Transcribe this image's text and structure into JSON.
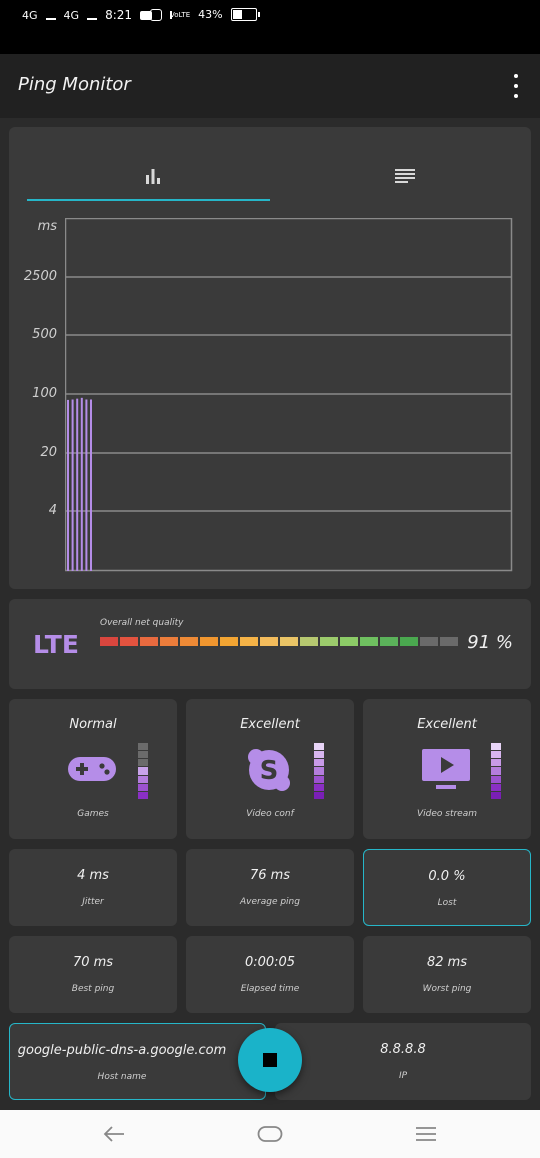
{
  "status_bar": {
    "net1": "4G",
    "net2": "4G",
    "time": "8:21",
    "volte": "VoLTE",
    "battery": "43%",
    "battery_level": 0.43
  },
  "app": {
    "title": "Ping Monitor"
  },
  "tabs": {
    "chart_icon": "bar-chart-icon",
    "list_icon": "list-icon"
  },
  "chart_data": {
    "type": "bar",
    "ylabel": "ms",
    "y_ticks": [
      "2500",
      "500",
      "100",
      "20",
      "4"
    ],
    "y_scale": "log",
    "series": [
      {
        "values": [
          85,
          86,
          88,
          90,
          86,
          86
        ]
      }
    ],
    "bar_color": "#b58de8"
  },
  "quality": {
    "network": "LTE",
    "label": "Overall net quality",
    "percent": "91 %",
    "segments": [
      "#d9463e",
      "#e3533f",
      "#e86a3f",
      "#ec7d3b",
      "#ee8a36",
      "#f0962f",
      "#f2a533",
      "#f5b347",
      "#f3bc5c",
      "#e9c466",
      "#b6c870",
      "#9ccb6c",
      "#8ccb67",
      "#6fc060",
      "#5bb25a",
      "#4aa84f",
      "#6a6a6a",
      "#6a6a6a"
    ]
  },
  "tiles": [
    {
      "title": "Normal",
      "sub": "Games",
      "icon": "gamepad-icon",
      "levels": [
        "#6b6b6b",
        "#6b6b6b",
        "#6b6b6b",
        "#c9a3ea",
        "#b47ddd",
        "#9c52cf",
        "#8a2fc4"
      ]
    },
    {
      "title": "Excellent",
      "sub": "Video conf",
      "icon": "skype-icon",
      "levels": [
        "#e8d4f7",
        "#d8b6f0",
        "#c89ae8",
        "#b47ddd",
        "#9c52cf",
        "#8a2fc4",
        "#7a1fb6"
      ]
    },
    {
      "title": "Excellent",
      "sub": "Video stream",
      "icon": "tv-play-icon",
      "levels": [
        "#e8d4f7",
        "#d8b6f0",
        "#c89ae8",
        "#b47ddd",
        "#9c52cf",
        "#8a2fc4",
        "#7a1fb6"
      ]
    }
  ],
  "stats": {
    "jitter": {
      "value": "4 ms",
      "label": "Jitter"
    },
    "average": {
      "value": "76 ms",
      "label": "Average ping"
    },
    "lost": {
      "value": "0.0 %",
      "label": "Lost"
    },
    "best": {
      "value": "70 ms",
      "label": "Best ping"
    },
    "elapsed": {
      "value": "0:00:05",
      "label": "Elapsed time"
    },
    "worst": {
      "value": "82 ms",
      "label": "Worst ping"
    }
  },
  "host": {
    "name": "google-public-dns-a.google.com",
    "name_label": "Host name",
    "ip": "8.8.8.8",
    "ip_label": "IP"
  },
  "fab": {
    "icon": "stop-icon"
  },
  "nav": {
    "back": "back-icon",
    "home": "home-icon",
    "recents": "menu-icon"
  }
}
